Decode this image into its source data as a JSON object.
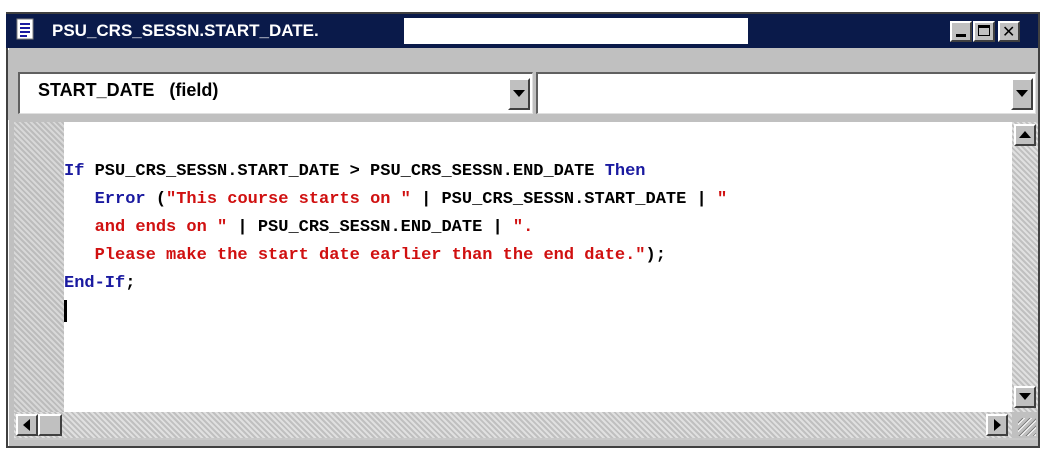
{
  "window": {
    "title": "PSU_CRS_SESSN.START_DATE."
  },
  "title_buttons": {
    "minimize_icon": "minimize-icon",
    "maximize_icon": "maximize-icon",
    "close_icon": "close-icon",
    "close_glyph": "✕"
  },
  "selectors": {
    "field_selector_value": "START_DATE   (field)",
    "event_selector_value": ""
  },
  "editor": {
    "line1_kw_if": "If",
    "line1_cond": " PSU_CRS_SESSN.START_DATE > PSU_CRS_SESSN.END_DATE ",
    "line1_kw_then": "Then",
    "line2_indent": "   ",
    "line2_kw_error": "Error",
    "line2_open": " (",
    "line2_str1": "\"This course starts on \"",
    "line2_mid": " | PSU_CRS_SESSN.START_DATE | ",
    "line2_str2": "\"",
    "line3_indent": "   ",
    "line3_str": "and ends on \"",
    "line3_mid": " | PSU_CRS_SESSN.END_DATE | ",
    "line3_str2": "\".",
    "line4_indent": "   ",
    "line4_str": "Please make the start date earlier than the end date.\"",
    "line4_end": ");",
    "line5_kw": "End-If",
    "line5_end": ";"
  },
  "colors": {
    "title_bar": "#0a1a4a",
    "keyword": "#1a1aa0",
    "string": "#d01010",
    "chrome": "#c0c0c0"
  }
}
